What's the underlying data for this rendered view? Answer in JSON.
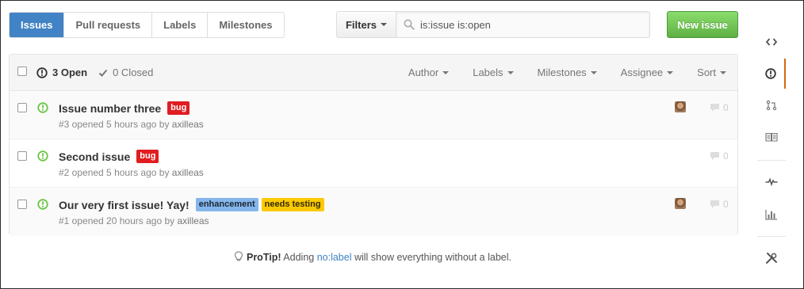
{
  "nav": {
    "tabs": [
      {
        "label": "Issues",
        "selected": true
      },
      {
        "label": "Pull requests"
      },
      {
        "label": "Labels"
      },
      {
        "label": "Milestones"
      }
    ]
  },
  "search": {
    "filters_label": "Filters",
    "query": "is:issue is:open"
  },
  "actions": {
    "new_issue_label": "New issue"
  },
  "table": {
    "open_label": "3 Open",
    "closed_label": "0 Closed",
    "filters": [
      "Author",
      "Labels",
      "Milestones",
      "Assignee",
      "Sort"
    ],
    "issues": [
      {
        "title": "Issue number three",
        "labels": [
          {
            "name": "bug",
            "color": "#e11d21",
            "text_color": "#ffffff"
          }
        ],
        "meta_prefix": "#3 opened 5 hours ago by ",
        "author": "axilleas",
        "assignee_avatar": true,
        "comments": "0"
      },
      {
        "title": "Second issue",
        "labels": [
          {
            "name": "bug",
            "color": "#e11d21",
            "text_color": "#ffffff"
          }
        ],
        "meta_prefix": "#2 opened 5 hours ago by ",
        "author": "axilleas",
        "assignee_avatar": false,
        "comments": "0"
      },
      {
        "title": "Our very first issue! Yay!",
        "labels": [
          {
            "name": "enhancement",
            "color": "#84b6eb",
            "text_color": "#1c2733"
          },
          {
            "name": "needs testing",
            "color": "#fbca04",
            "text_color": "#332900"
          }
        ],
        "meta_prefix": "#1 opened 20 hours ago by ",
        "author": "axilleas",
        "assignee_avatar": true,
        "comments": "0"
      }
    ]
  },
  "protip": {
    "prefix": "ProTip!",
    "text_before": " Adding ",
    "link": "no:label",
    "text_after": " will show everything without a label."
  },
  "colors": {
    "accent": "#4183c4",
    "new_issue_green": "#6cc644",
    "open_icon": "#6cc644",
    "active_sidebar": "#d26911"
  },
  "sidebar": {
    "icons": [
      "code-icon",
      "issue-opened-icon",
      "pull-request-icon",
      "wiki-book-icon",
      "pulse-icon",
      "graph-icon",
      "settings-tools-icon"
    ],
    "active": "issue-opened-icon"
  }
}
